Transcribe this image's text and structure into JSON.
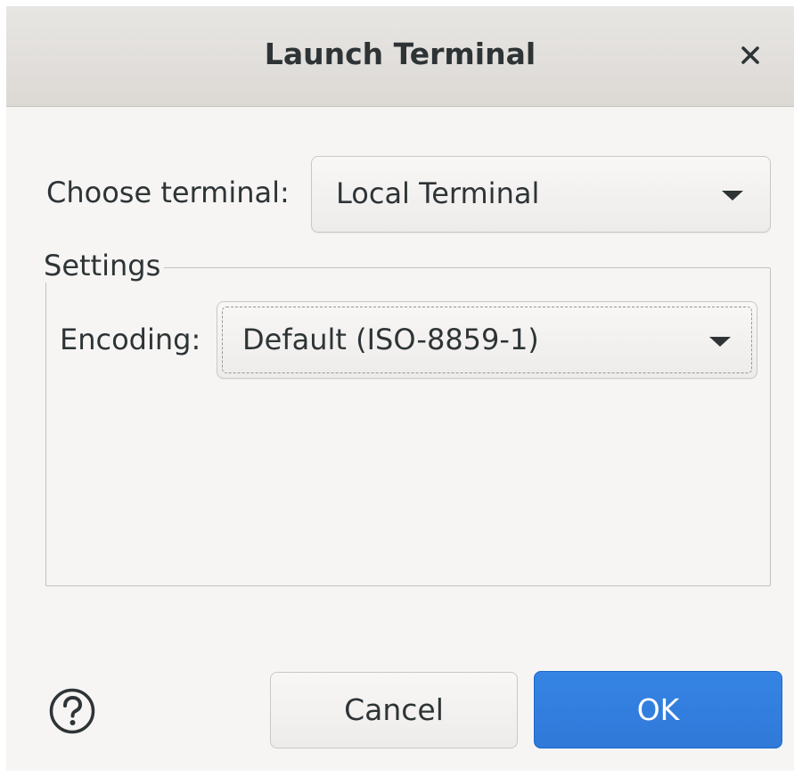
{
  "dialog": {
    "title": "Launch Terminal",
    "close_icon": "close-icon"
  },
  "terminal": {
    "label": "Choose terminal:",
    "selected": "Local Terminal",
    "arrow_icon": "chevron-down-icon"
  },
  "settings": {
    "legend": "Settings",
    "encoding_label": "Encoding:",
    "encoding_selected": "Default (ISO-8859-1)",
    "arrow_icon": "chevron-down-icon"
  },
  "footer": {
    "help_icon": "help-icon",
    "cancel_label": "Cancel",
    "ok_label": "OK"
  },
  "colors": {
    "dialog_bg": "#f6f5f4",
    "titlebar_bg": "#e2e0dc",
    "accent": "#3584e4",
    "text": "#2e3436"
  }
}
